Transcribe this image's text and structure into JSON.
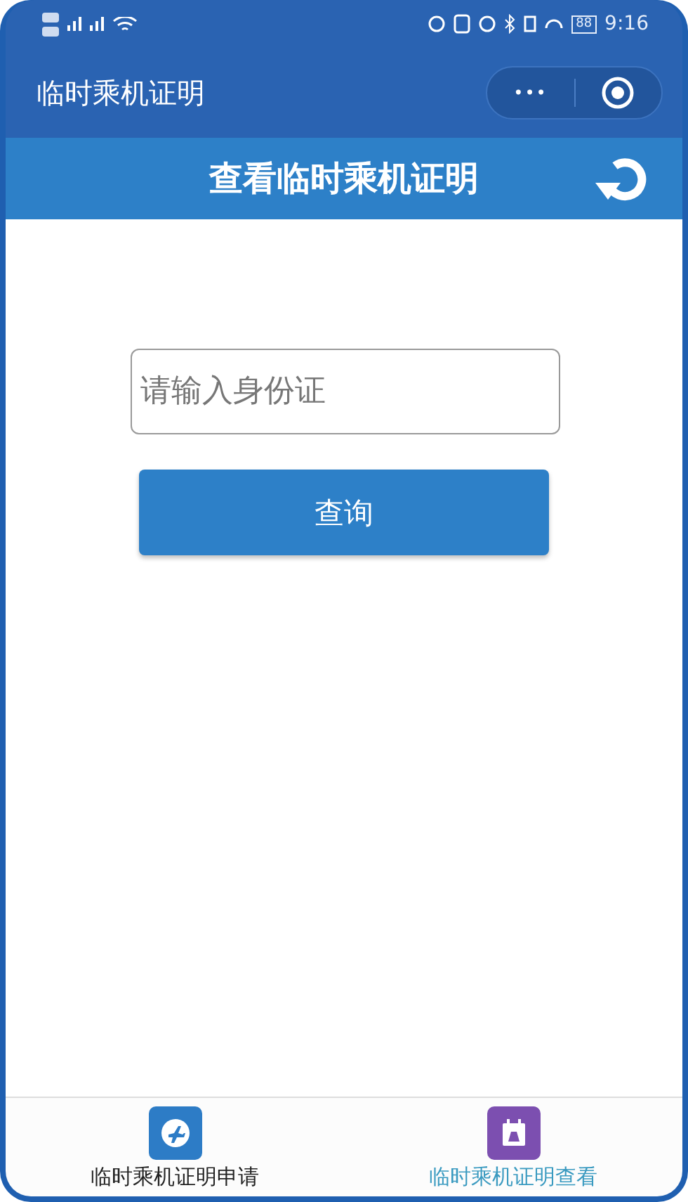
{
  "status_bar": {
    "battery": "88",
    "time": "9:16"
  },
  "nav_bar": {
    "title": "临时乘机证明",
    "menu_button": "•••"
  },
  "header": {
    "title": "查看临时乘机证明"
  },
  "id_field": {
    "placeholder": "请输入身份证"
  },
  "query_button": {
    "label": "查询"
  },
  "tab_bar": [
    {
      "label": "临时乘机证明申请",
      "kind": "plane",
      "selected": false
    },
    {
      "label": "临时乘机证明查看",
      "kind": "calendar",
      "selected": true
    }
  ]
}
